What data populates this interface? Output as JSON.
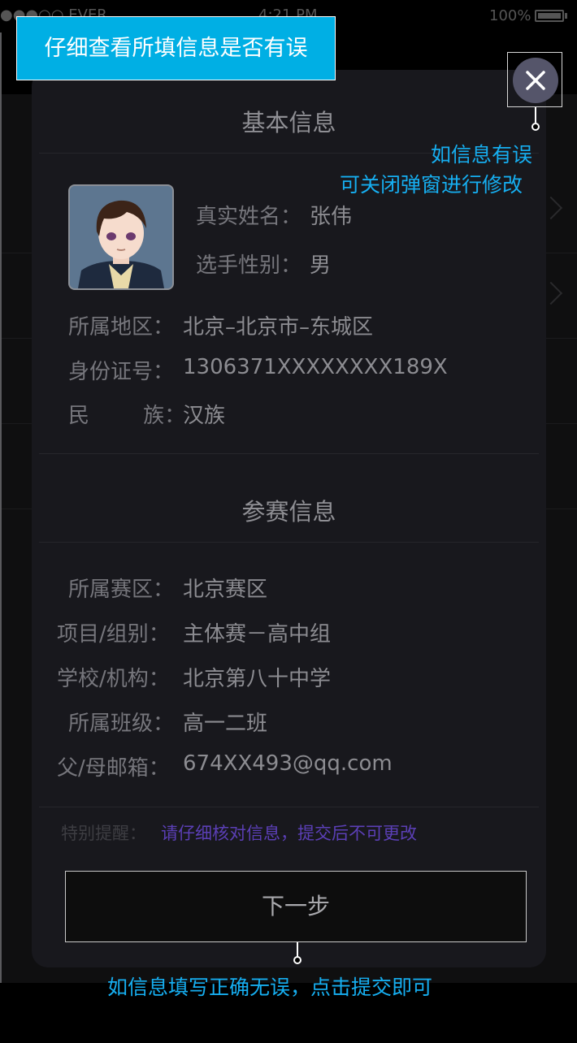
{
  "status_bar": {
    "carrier": "●●●○○ EVER",
    "time": "4:21 PM",
    "battery": "100%"
  },
  "tip_banner": "仔细查看所填信息是否有误",
  "close_callout": {
    "line1": "如信息有误",
    "line2": "可关闭弹窗进行修改"
  },
  "modal": {
    "basic_title": "基本信息",
    "name_label": "真实姓名：",
    "name_value": "张伟",
    "gender_label": "选手性别：",
    "gender_value": "男",
    "region_label": "所属地区：",
    "region_value": "北京–北京市–东城区",
    "id_label": "身份证号：",
    "id_value": "1306371XXXXXXXX189X",
    "ethnicity_label": "民        族：",
    "ethnicity_value": "汉族",
    "contest_title": "参赛信息",
    "division_label": "所属赛区：",
    "division_value": "北京赛区",
    "project_label": "项目/组别：",
    "project_value": "主体赛－高中组",
    "school_label": "学校/机构：",
    "school_value": "北京第八十中学",
    "class_label": "所属班级：",
    "class_value": "高一二班",
    "email_label": "父/母邮箱：",
    "email_value": "674XX493@qq.com",
    "notice_label": "特别提醒：",
    "notice_text": "请仔细核对信息，提交后不可更改",
    "next_label": "下一步"
  },
  "next_callout": "如信息填写正确无误，点击提交即可",
  "colors": {
    "accent": "#00afe4",
    "callout_text": "#16aef0",
    "notice_purple": "#5b3fb6",
    "modal_bg": "#18181d"
  },
  "icons": {
    "close": "close-icon",
    "avatar": "avatar-illustration"
  }
}
